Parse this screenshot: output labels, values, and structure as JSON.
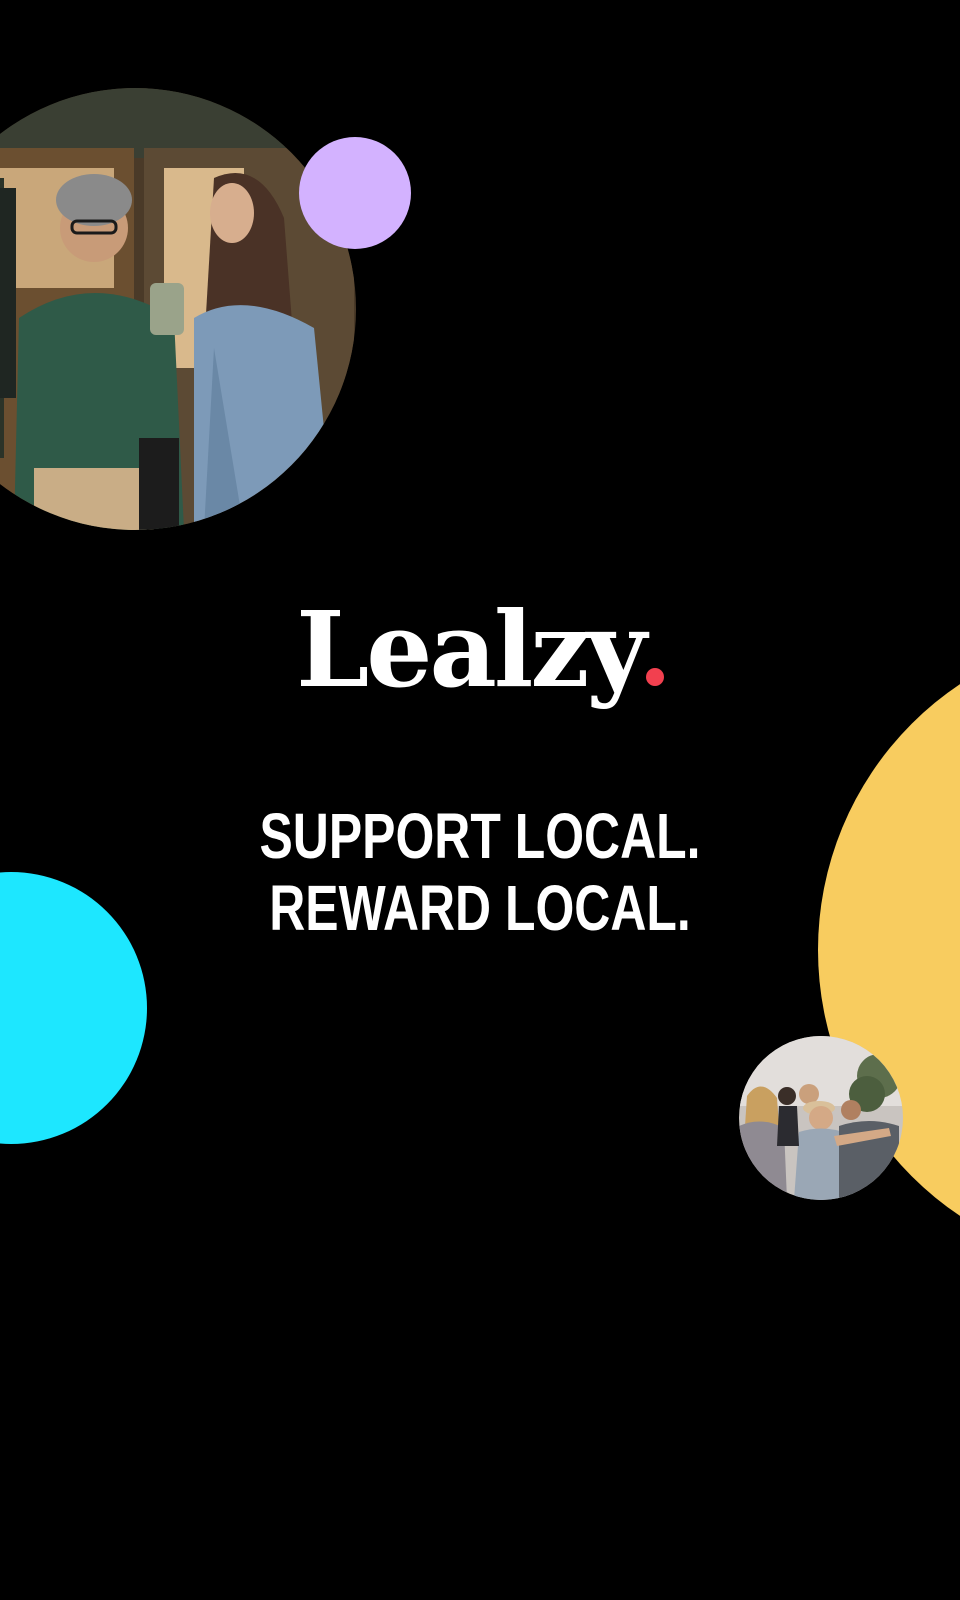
{
  "brand": {
    "name": "Lealzy",
    "dot_color": "#f2404f"
  },
  "tagline": {
    "line1": "SUPPORT LOCAL.",
    "line2": "REWARD LOCAL."
  },
  "colors": {
    "background": "#000000",
    "lavender": "#d3b2ff",
    "cyan": "#1de7ff",
    "yellow": "#f8cc5f",
    "text": "#ffffff"
  },
  "photos": {
    "top": "couple-walking-out-of-cafe-photo",
    "bottom": "friends-sitting-outdoors-photo"
  }
}
